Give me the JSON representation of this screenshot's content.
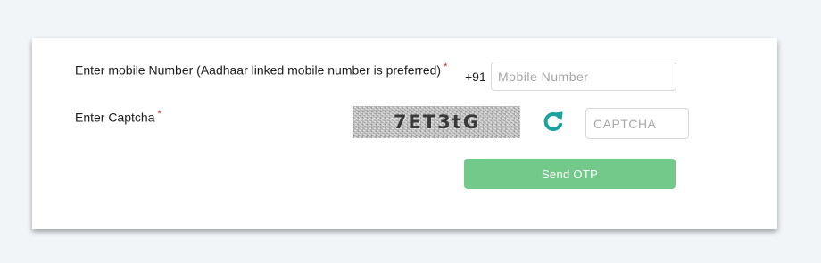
{
  "form": {
    "mobile_label": "Enter mobile Number (Aadhaar linked mobile number is preferred)",
    "required_marker": "*",
    "country_code": "+91",
    "mobile_placeholder": "Mobile Number",
    "mobile_value": "",
    "captcha_label": "Enter Captcha",
    "captcha_image_text": "7ET3tG",
    "captcha_placeholder": "CAPTCHA",
    "captcha_value": "",
    "refresh_icon": "refresh-icon",
    "send_button_label": "Send OTP"
  },
  "colors": {
    "page_background": "#f2f5f8",
    "card_background": "#ffffff",
    "required_marker": "#e02020",
    "refresh_icon": "#1aa3a0",
    "send_button": "#72c98a"
  }
}
